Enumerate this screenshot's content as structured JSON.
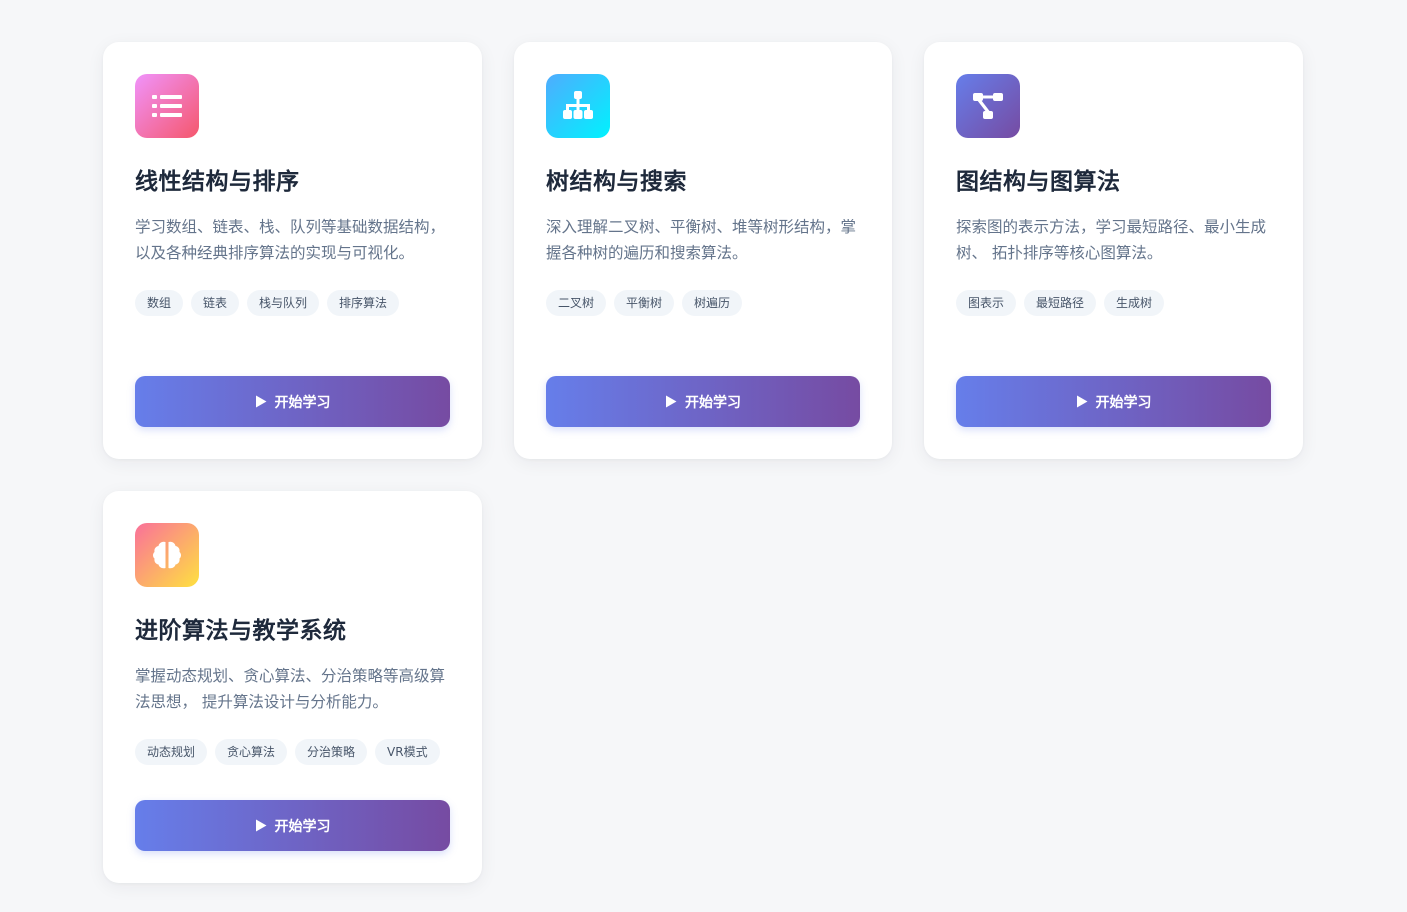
{
  "cards": [
    {
      "icon": "list-icon",
      "title": "线性结构与排序",
      "description": "学习数组、链表、栈、队列等基础数据结构， 以及各种经典排序算法的实现与可视化。",
      "tags": [
        "数组",
        "链表",
        "栈与队列",
        "排序算法"
      ],
      "button": "开始学习"
    },
    {
      "icon": "sitemap-icon",
      "title": "树结构与搜索",
      "description": "深入理解二叉树、平衡树、堆等树形结构，掌握各种树的遍历和搜索算法。",
      "tags": [
        "二叉树",
        "平衡树",
        "树遍历"
      ],
      "button": "开始学习"
    },
    {
      "icon": "project-diagram-icon",
      "title": "图结构与图算法",
      "description": "探索图的表示方法，学习最短路径、最小生成树、 拓扑排序等核心图算法。",
      "tags": [
        "图表示",
        "最短路径",
        "生成树"
      ],
      "button": "开始学习"
    },
    {
      "icon": "brain-icon",
      "title": "进阶算法与教学系统",
      "description": "掌握动态规划、贪心算法、分治策略等高级算法思想， 提升算法设计与分析能力。",
      "tags": [
        "动态规划",
        "贪心算法",
        "分治策略",
        "VR模式"
      ],
      "button": "开始学习"
    }
  ],
  "colors": {
    "button_gradient": [
      "#667eea",
      "#764ba2"
    ],
    "icon_pink": [
      "#f093fb",
      "#f5576c"
    ],
    "icon_blue": [
      "#4facfe",
      "#00f2fe"
    ],
    "icon_purple": [
      "#667eea",
      "#764ba2"
    ],
    "icon_orange": [
      "#fa709a",
      "#fee140"
    ]
  }
}
